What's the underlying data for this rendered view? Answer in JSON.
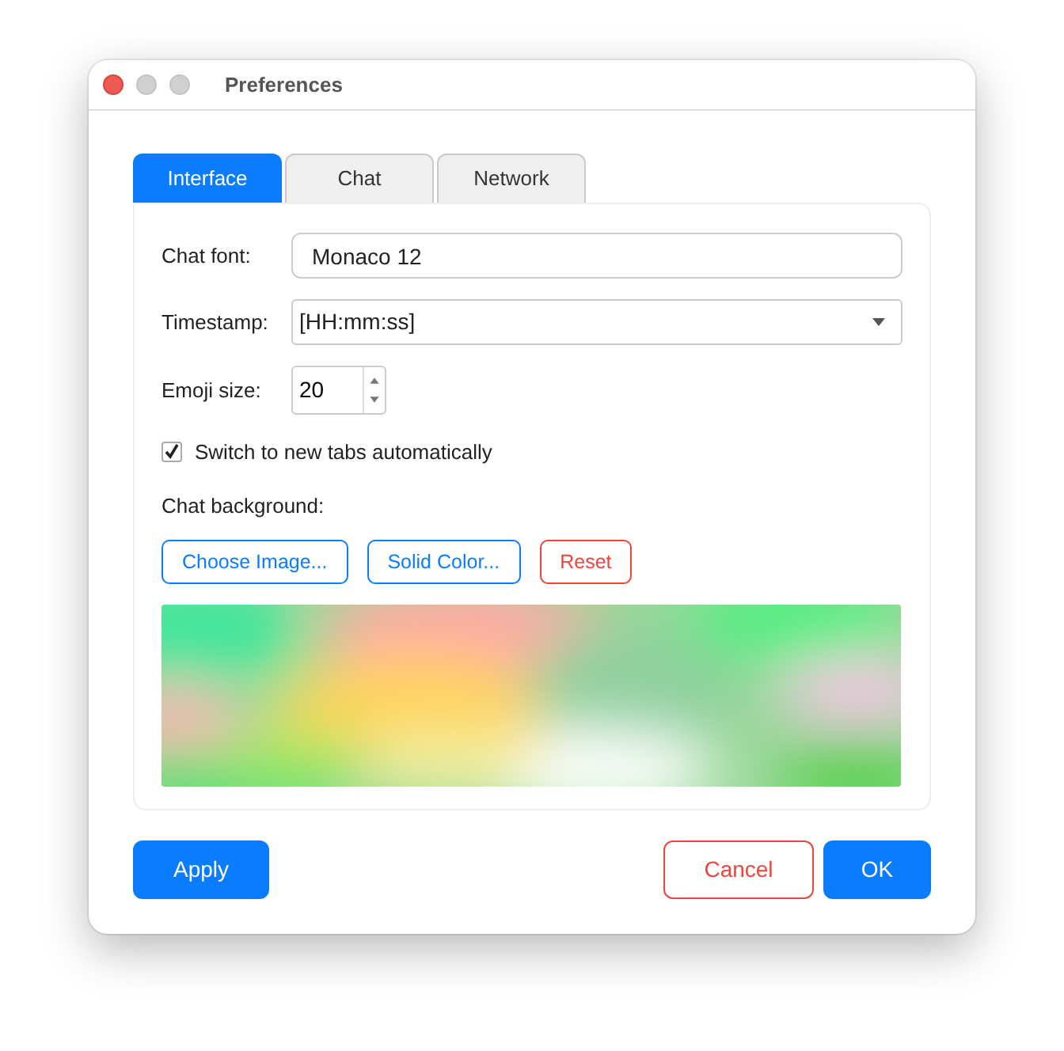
{
  "window": {
    "title": "Preferences"
  },
  "tabs": [
    {
      "label": "Interface",
      "selected": true
    },
    {
      "label": "Chat",
      "selected": false
    },
    {
      "label": "Network",
      "selected": false
    }
  ],
  "chat_font": {
    "label": "Chat font:",
    "value": "Monaco 12"
  },
  "timestamp": {
    "label": "Timestamp:",
    "value": "[HH:mm:ss]"
  },
  "emoji_size": {
    "label": "Emoji size:",
    "value": "20"
  },
  "switch_tabs": {
    "label": "Switch to new tabs automatically",
    "checked": true
  },
  "chat_background": {
    "label": "Chat background:",
    "buttons": [
      {
        "label": "Choose Image...",
        "kind": "outline-blue"
      },
      {
        "label": "Solid Color...",
        "kind": "outline-blue"
      },
      {
        "label": "Reset",
        "kind": "outline-red"
      }
    ]
  },
  "footer": {
    "left": [
      {
        "label": "Apply",
        "kind": "filled"
      }
    ],
    "right": [
      {
        "label": "Cancel",
        "kind": "outline-red"
      },
      {
        "label": "OK",
        "kind": "filled"
      }
    ]
  }
}
